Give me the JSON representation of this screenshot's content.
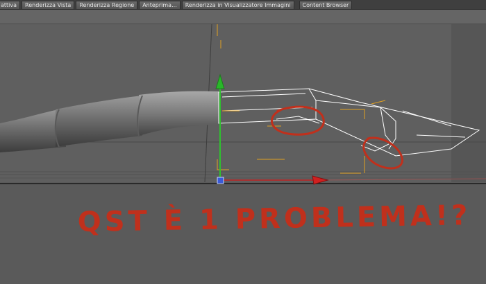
{
  "toolbar": {
    "buttons": [
      {
        "label": "attiva"
      },
      {
        "label": "Renderizza Vista"
      },
      {
        "label": "Renderizza Regione"
      },
      {
        "label": "Anteprima..."
      },
      {
        "label": "Renderizza in Visualizzatore Immagini"
      },
      {
        "label": "Content Browser"
      }
    ]
  },
  "annotation": {
    "text": "QST È 1 PROBLEMA!?",
    "color": "#c0301c"
  },
  "colors": {
    "viewport_bg": "#5e5e5e",
    "axis_y": "#2fc12f",
    "axis_x": "#d02020",
    "wireframe": "#ffffff",
    "bounding": "#e0a020"
  }
}
